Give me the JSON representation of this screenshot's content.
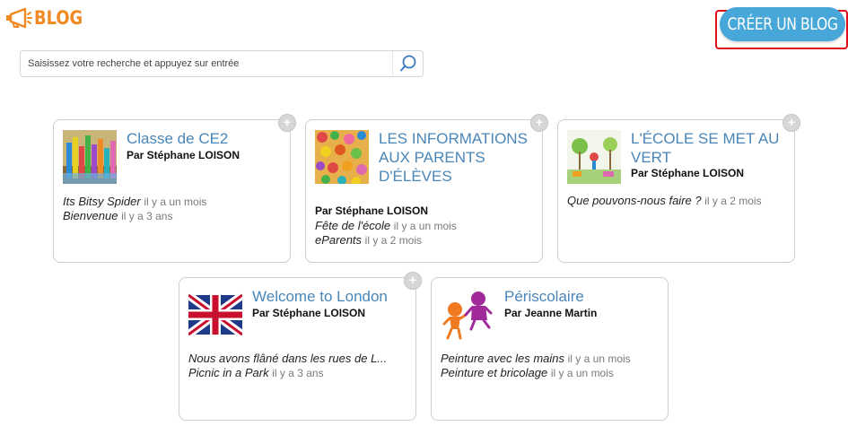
{
  "header": {
    "logo_text": "BLOG",
    "create_button": "CRÉER UN BLOG"
  },
  "search": {
    "placeholder": "Saisissez votre recherche et appuyez sur entrée"
  },
  "colors": {
    "accent_orange": "#f08a24",
    "button_blue": "#47a7d9",
    "title_blue": "#4a86b8",
    "highlight_red": "#e0101a"
  },
  "blogs": [
    {
      "title": "Classe de CE2",
      "author": "Par Stéphane LOISON",
      "posts": [
        {
          "title": "Its Bitsy Spider",
          "date": "il y a un mois"
        },
        {
          "title": "Bienvenue",
          "date": "il y a 3 ans"
        }
      ]
    },
    {
      "title": "LES INFORMATIONS AUX PARENTS D'ÉLÈVES",
      "author": "Par Stéphane LOISON",
      "posts": [
        {
          "title": "Fête de l'école",
          "date": "il y a un mois"
        },
        {
          "title": "eParents",
          "date": "il y a 2 mois"
        }
      ]
    },
    {
      "title": "L'ÉCOLE SE MET AU VERT",
      "author": "Par Stéphane LOISON",
      "posts": [
        {
          "title": "Que pouvons-nous faire ?",
          "date": "il y a 2 mois"
        }
      ]
    },
    {
      "title": "Welcome to London",
      "author": "Par Stéphane LOISON",
      "posts": [
        {
          "title": "Nous avons flâné dans les rues de L...",
          "date": ""
        },
        {
          "title": "Picnic in a Park",
          "date": "il y a 3 ans"
        }
      ]
    },
    {
      "title": "Périscolaire",
      "author": "Par Jeanne Martin",
      "posts": [
        {
          "title": "Peinture avec les mains",
          "date": "il y a un mois"
        },
        {
          "title": "Peinture et bricolage",
          "date": "il y a un mois"
        }
      ]
    }
  ]
}
